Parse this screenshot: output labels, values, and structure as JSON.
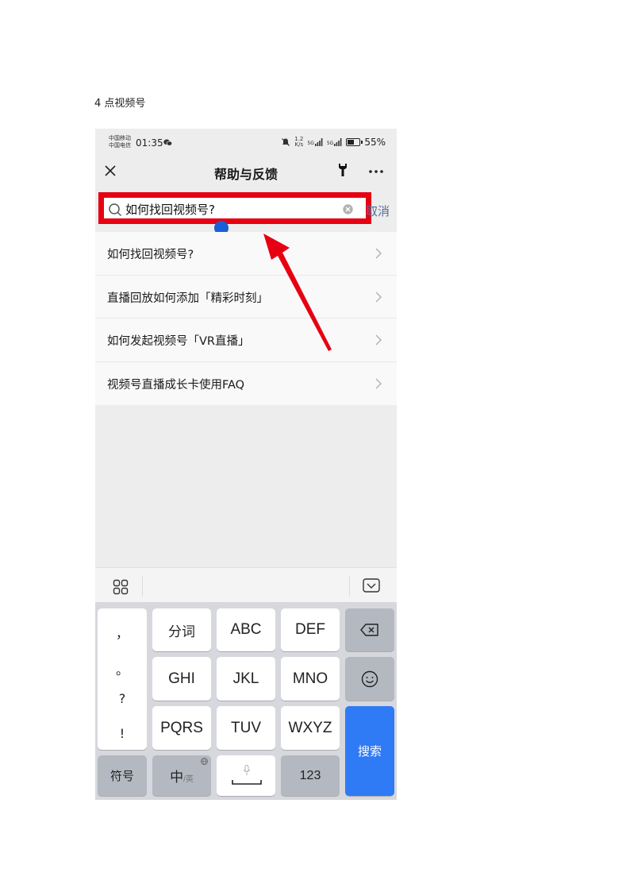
{
  "document": {
    "caption": "4 点视频号"
  },
  "status_bar": {
    "carrier_1": "中国移动",
    "carrier_2": "中国电信",
    "time": "01:35",
    "speed_value": "1.2",
    "speed_unit": "K/s",
    "signal_1": "5G",
    "signal_2": "5G",
    "battery": "55%"
  },
  "nav": {
    "title": "帮助与反馈"
  },
  "search": {
    "query": "如何找回视频号?",
    "cancel_label": "取消"
  },
  "results": [
    {
      "text": "如何找回视频号?"
    },
    {
      "text": "直播回放如何添加「精彩时刻」"
    },
    {
      "text": "如何发起视频号「VR直播」"
    },
    {
      "text": "视频号直播成长卡使用FAQ"
    }
  ],
  "keyboard": {
    "punctuation": [
      "，",
      "。",
      "?",
      "!"
    ],
    "row1": [
      "分词",
      "ABC",
      "DEF"
    ],
    "row2": [
      "GHI",
      "JKL",
      "MNO"
    ],
    "row3": [
      "PQRS",
      "TUV",
      "WXYZ"
    ],
    "symbols_label": "符号",
    "lang_main": "中",
    "lang_sub": "/英",
    "numbers_label": "123",
    "search_label": "搜索"
  },
  "colors": {
    "highlight": "#e60012",
    "search_key": "#2f7af5",
    "cancel_link": "#576b95",
    "cursor_handle": "#1a5fd6"
  },
  "icons": [
    "close-icon",
    "wrench-icon",
    "more-icon",
    "search-icon",
    "clear-icon",
    "chevron-right-icon",
    "grid-icon",
    "collapse-keyboard-icon",
    "backspace-icon",
    "emoji-icon",
    "mic-icon",
    "globe-icon"
  ]
}
